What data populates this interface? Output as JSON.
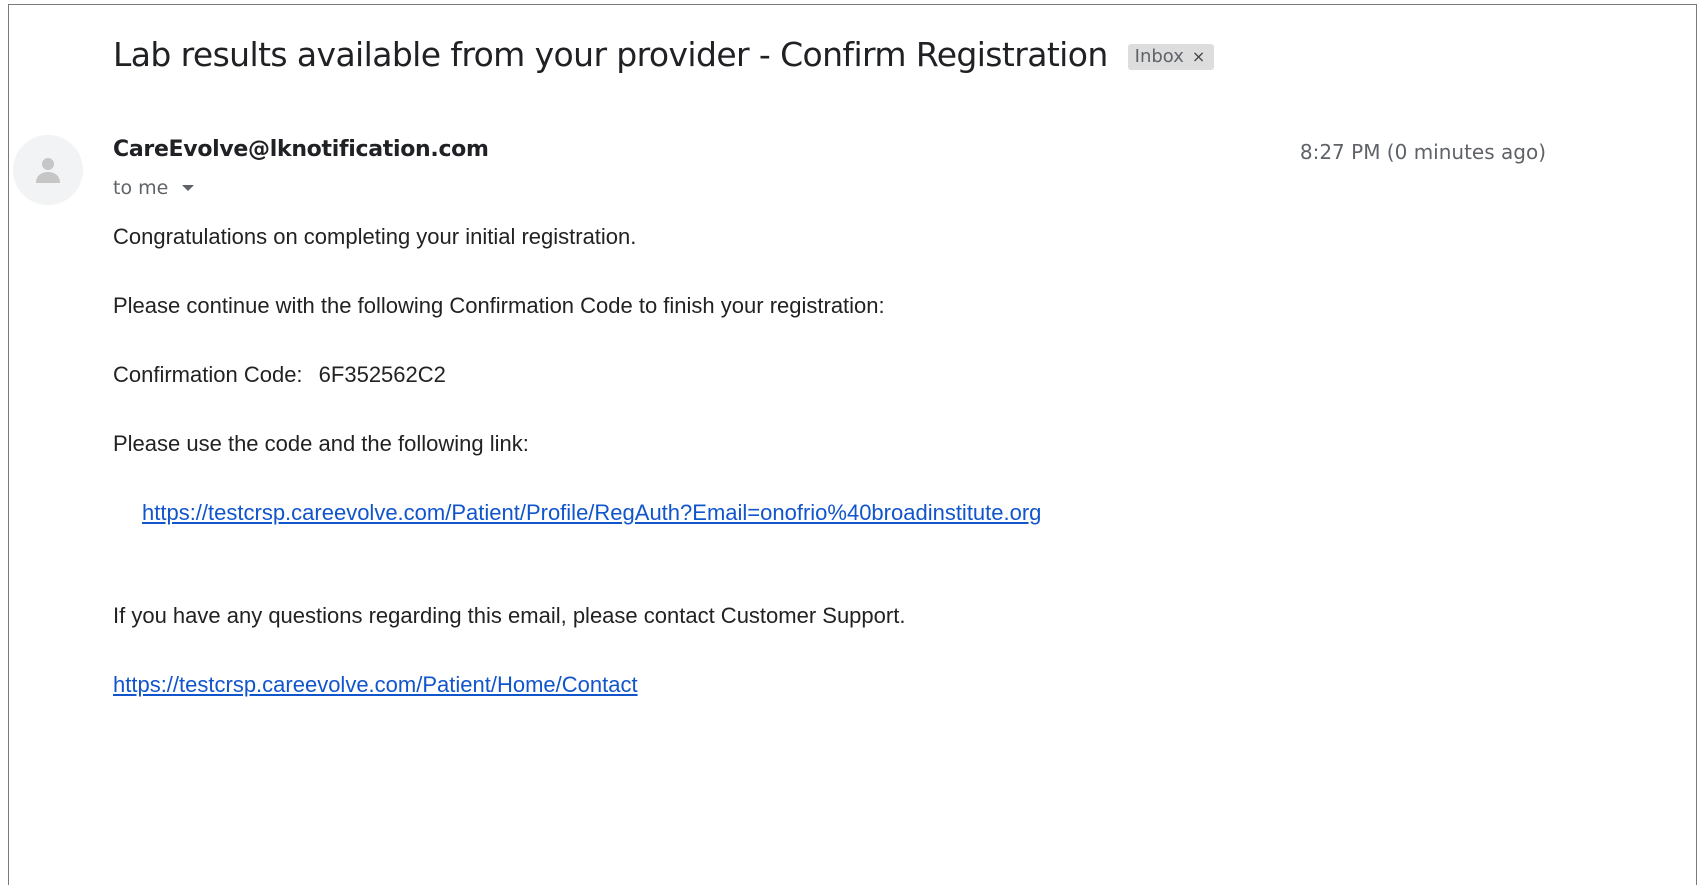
{
  "email": {
    "subject": "Lab results available from your provider - Confirm Registration",
    "label": "Inbox",
    "label_close": "×",
    "sender": "CareEvolve@lknotification.com",
    "timestamp": "8:27 PM (0 minutes ago)",
    "recipient": "to me",
    "body": {
      "line1": "Congratulations on completing your initial registration.",
      "line2": "Please continue with the following Confirmation Code to finish your registration:",
      "code_label": "Confirmation Code:",
      "code_value": "6F352562C2",
      "line3": "Please use the code and the following link:",
      "link1": "https://testcrsp.careevolve.com/Patient/Profile/RegAuth?Email=onofrio%40broadinstitute.org",
      "line4": "If you have any questions regarding this email, please contact Customer Support.",
      "link2": "https://testcrsp.careevolve.com/Patient/Home/Contact"
    }
  },
  "icons": {
    "avatar": "person-icon",
    "recipient_dropdown": "caret-down-icon"
  },
  "colors": {
    "link": "#1155cc",
    "label_bg": "#dddddd",
    "secondary_text": "#5f6368"
  }
}
